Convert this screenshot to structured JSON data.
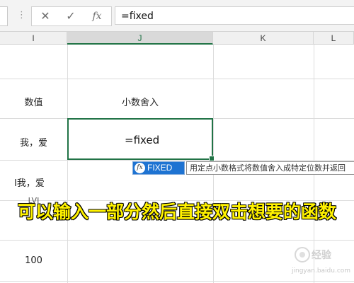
{
  "formula_bar": {
    "separator": "⋮",
    "cancel_icon": "✕",
    "enter_icon": "✓",
    "fx_label": "fx",
    "formula": "=fixed"
  },
  "columns": {
    "i": "I",
    "j": "J",
    "k": "K",
    "l": "L"
  },
  "cells": {
    "i_header": "数值",
    "j_header": "小数舍入",
    "i_row2": "我，爱",
    "i_row3": "I我，爱ᅠ",
    "i_row4": "LVI",
    "i_row5": "100",
    "j_edit": "=fixed"
  },
  "autocomplete": {
    "icon": "fx",
    "item": "FIXED",
    "tooltip": "用定点小数格式将数值舍入成特定位数并返回"
  },
  "caption": "可以输入一部分然后直接双击想要的函数",
  "watermark": {
    "brand": "经验",
    "url": "jingyan.baidu.com"
  }
}
